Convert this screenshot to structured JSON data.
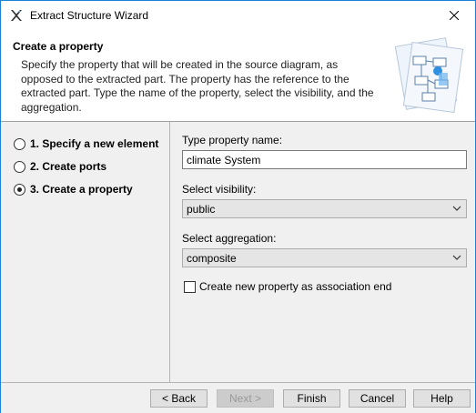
{
  "window": {
    "title": "Extract Structure Wizard",
    "close_icon": "close-icon",
    "app_icon": "magicdraw-app-icon"
  },
  "header": {
    "title": "Create a property",
    "description": "Specify the property that will be created in the source diagram, as opposed to the extracted part. The property has the reference to the extracted part. Type the name of the property, select the visibility, and the aggregation.",
    "banner_icon": "wizard-diagram-banner"
  },
  "steps": [
    {
      "label": "1. Specify a new element",
      "selected": false
    },
    {
      "label": "2. Create ports",
      "selected": false
    },
    {
      "label": "3. Create a property",
      "selected": true
    }
  ],
  "form": {
    "name_label": "Type property name:",
    "name_value": "climate System",
    "visibility_label": "Select visibility:",
    "visibility_value": "public",
    "aggregation_label": "Select aggregation:",
    "aggregation_value": "composite",
    "assoc_end_label": "Create new property as association end",
    "assoc_end_checked": false
  },
  "buttons": {
    "back": "< Back",
    "next": "Next >",
    "finish": "Finish",
    "cancel": "Cancel",
    "help": "Help"
  }
}
